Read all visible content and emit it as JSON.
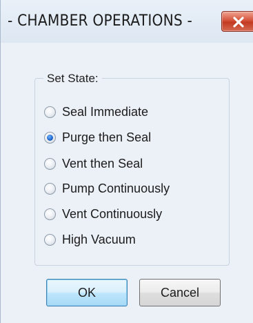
{
  "window": {
    "title": "- CHAMBER OPERATIONS -"
  },
  "group": {
    "label": "Set State:",
    "options": [
      {
        "label": "Seal Immediate",
        "checked": false
      },
      {
        "label": "Purge then Seal",
        "checked": true
      },
      {
        "label": "Vent then Seal",
        "checked": false
      },
      {
        "label": "Pump Continuously",
        "checked": false
      },
      {
        "label": "Vent Continuously",
        "checked": false
      },
      {
        "label": "High Vacuum",
        "checked": false
      }
    ]
  },
  "buttons": {
    "ok_label": "OK",
    "cancel_label": "Cancel"
  },
  "colors": {
    "close_button": "#c9432c",
    "radio_selected": "#1f64c8",
    "default_button_border": "#3c7fb1"
  }
}
